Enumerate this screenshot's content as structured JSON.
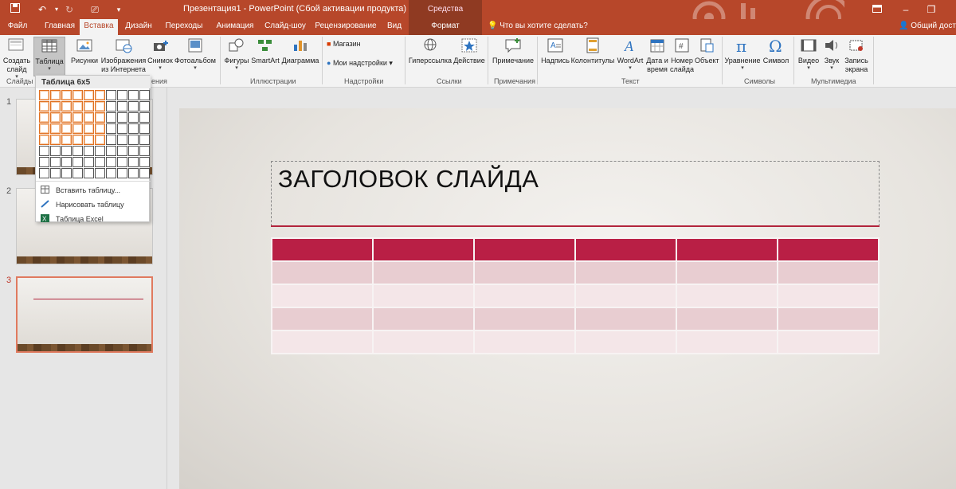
{
  "window": {
    "title": "Презентация1 - PowerPoint (Сбой активации продукта)",
    "contextual_tab_group": "Средства рисования"
  },
  "tabs": [
    "Файл",
    "Главная",
    "Вставка",
    "Дизайн",
    "Переходы",
    "Анимация",
    "Слайд-шоу",
    "Рецензирование",
    "Вид",
    "Формат"
  ],
  "active_tab": "Вставка",
  "tell_me": "Что вы хотите сделать?",
  "share": "Общий доступ",
  "ribbon": {
    "buttons": {
      "new_slide": "Создать слайд",
      "table": "Таблица",
      "pictures": "Рисунки",
      "online_pictures": "Изображения из Интернета",
      "screenshot": "Снимок",
      "photo_album": "Фотоальбом",
      "shapes": "Фигуры",
      "smartart": "SmartArt",
      "chart": "Диаграмма",
      "store": "Магазин",
      "my_addins": "Мои надстройки",
      "hyperlink": "Гиперссылка",
      "action": "Действие",
      "comment": "Примечание",
      "textbox": "Надпись",
      "header_footer": "Колонтитулы",
      "wordart": "WordArt",
      "date_time": "Дата и время",
      "slide_number": "Номер слайда",
      "object": "Объект",
      "equation": "Уравнение",
      "symbol": "Символ",
      "video": "Видео",
      "audio": "Звук",
      "screen_recording": "Запись экрана"
    },
    "groups": {
      "slides": "Слайды",
      "images_partial": "ения",
      "illustrations": "Иллюстрации",
      "addins": "Надстройки",
      "links": "Ссылки",
      "comments": "Примечания",
      "text": "Текст",
      "symbols": "Символы",
      "media": "Мультимедиа"
    }
  },
  "table_dropdown": {
    "title": "Таблица 6x5",
    "grid_columns": 10,
    "grid_rows": 8,
    "selected_columns": 6,
    "selected_rows": 5,
    "items": [
      "Вставить таблицу...",
      "Нарисовать таблицу",
      "Таблица Excel"
    ]
  },
  "slides": {
    "numbers": [
      "1",
      "2",
      "3"
    ],
    "selected": "3"
  },
  "slide": {
    "title": "ЗАГОЛОВОК СЛАЙДА",
    "table": {
      "columns": 6,
      "rows": 5
    }
  },
  "colors": {
    "accent": "#b7472a",
    "table_header": "#b91f45",
    "table_band": "#e8cdd1",
    "table_light": "#f4e6e8",
    "title_rule": "#b2243c"
  }
}
